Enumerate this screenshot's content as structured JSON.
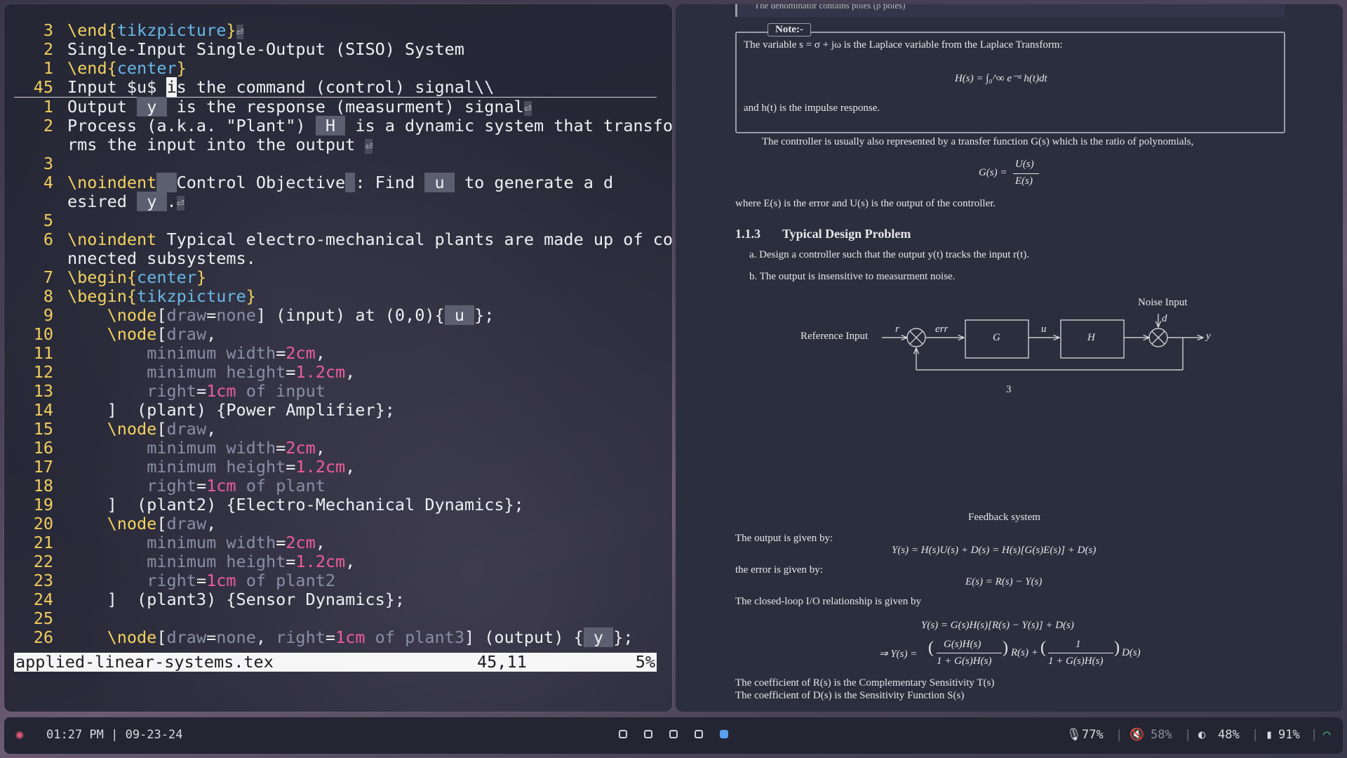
{
  "editor": {
    "lines": [
      {
        "n": "3",
        "segs": [
          [
            "kw",
            "\\end{"
          ],
          [
            "arg",
            "tikzpicture"
          ],
          [
            "kw",
            "}"
          ],
          [
            "ret",
            "⏎"
          ]
        ]
      },
      {
        "n": "2",
        "segs": [
          [
            "t",
            "Single-Input Single-Output (SISO) System"
          ]
        ]
      },
      {
        "n": "1",
        "segs": [
          [
            "kw",
            "\\end{"
          ],
          [
            "arg",
            "center"
          ],
          [
            "kw",
            "}"
          ]
        ]
      },
      {
        "n": "45",
        "cur": true,
        "segs": [
          [
            "t",
            "Input $u$ "
          ],
          [
            "caret",
            "i"
          ],
          [
            "t",
            "s the command (control) signal\\\\"
          ]
        ]
      },
      {
        "n": "1",
        "segs": [
          [
            "t",
            "Output "
          ],
          [
            "mk",
            " y "
          ],
          [
            "t",
            " is the response (measurment) signal"
          ],
          [
            "ret",
            "⏎"
          ]
        ]
      },
      {
        "n": "2",
        "segs": [
          [
            "t",
            "Process (a.k.a. \"Plant\") "
          ],
          [
            "mk",
            " H "
          ],
          [
            "t",
            " is a dynamic system that transfo"
          ]
        ]
      },
      {
        "n": "",
        "segs": [
          [
            "t",
            "rms the input into the output "
          ],
          [
            "ret",
            "⏎"
          ]
        ]
      },
      {
        "n": "3",
        "segs": []
      },
      {
        "n": "4",
        "segs": [
          [
            "kw",
            "\\noindent"
          ],
          [
            "mk",
            "  "
          ],
          [
            "t",
            "Control Objective"
          ],
          [
            "mk",
            " "
          ],
          [
            "t",
            ": Find "
          ],
          [
            "mk",
            " u "
          ],
          [
            "t",
            " to generate a d"
          ]
        ]
      },
      {
        "n": "",
        "segs": [
          [
            "t",
            "esired "
          ],
          [
            "mk",
            " y "
          ],
          [
            "t",
            "."
          ],
          [
            "ret",
            "⏎"
          ]
        ]
      },
      {
        "n": "5",
        "segs": []
      },
      {
        "n": "6",
        "segs": [
          [
            "kw",
            "\\noindent"
          ],
          [
            "t",
            " Typical electro-mechanical plants are made up of co"
          ]
        ]
      },
      {
        "n": "",
        "segs": [
          [
            "t",
            "nnected subsystems."
          ]
        ]
      },
      {
        "n": "7",
        "segs": [
          [
            "kw",
            "\\begin{"
          ],
          [
            "arg",
            "center"
          ],
          [
            "kw",
            "}"
          ]
        ]
      },
      {
        "n": "8",
        "segs": [
          [
            "kw",
            "\\begin{"
          ],
          [
            "arg",
            "tikzpicture"
          ],
          [
            "kw",
            "}"
          ]
        ]
      },
      {
        "n": "9",
        "segs": [
          [
            "t",
            "    "
          ],
          [
            "kw",
            "\\node"
          ],
          [
            "t",
            "["
          ],
          [
            "opt",
            "draw"
          ],
          [
            "t",
            "="
          ],
          [
            "opt",
            "none"
          ],
          [
            "t",
            "] (input) at (0,0){"
          ],
          [
            "mk",
            " u "
          ],
          [
            "t",
            "};"
          ]
        ]
      },
      {
        "n": "10",
        "segs": [
          [
            "t",
            "    "
          ],
          [
            "kw",
            "\\node"
          ],
          [
            "t",
            "["
          ],
          [
            "opt",
            "draw"
          ],
          [
            "t",
            ","
          ]
        ]
      },
      {
        "n": "11",
        "segs": [
          [
            "t",
            "        "
          ],
          [
            "opt",
            "minimum width"
          ],
          [
            "t",
            "="
          ],
          [
            "num",
            "2cm"
          ],
          [
            "t",
            ","
          ]
        ]
      },
      {
        "n": "12",
        "segs": [
          [
            "t",
            "        "
          ],
          [
            "opt",
            "minimum height"
          ],
          [
            "t",
            "="
          ],
          [
            "num",
            "1.2cm"
          ],
          [
            "t",
            ","
          ]
        ]
      },
      {
        "n": "13",
        "segs": [
          [
            "t",
            "        "
          ],
          [
            "opt",
            "right"
          ],
          [
            "t",
            "="
          ],
          [
            "num",
            "1cm"
          ],
          [
            "opt",
            " of input"
          ]
        ]
      },
      {
        "n": "14",
        "segs": [
          [
            "t",
            "    ]  (plant) {Power Amplifier};"
          ]
        ]
      },
      {
        "n": "15",
        "segs": [
          [
            "t",
            "    "
          ],
          [
            "kw",
            "\\node"
          ],
          [
            "t",
            "["
          ],
          [
            "opt",
            "draw"
          ],
          [
            "t",
            ","
          ]
        ]
      },
      {
        "n": "16",
        "segs": [
          [
            "t",
            "        "
          ],
          [
            "opt",
            "minimum width"
          ],
          [
            "t",
            "="
          ],
          [
            "num",
            "2cm"
          ],
          [
            "t",
            ","
          ]
        ]
      },
      {
        "n": "17",
        "segs": [
          [
            "t",
            "        "
          ],
          [
            "opt",
            "minimum height"
          ],
          [
            "t",
            "="
          ],
          [
            "num",
            "1.2cm"
          ],
          [
            "t",
            ","
          ]
        ]
      },
      {
        "n": "18",
        "segs": [
          [
            "t",
            "        "
          ],
          [
            "opt",
            "right"
          ],
          [
            "t",
            "="
          ],
          [
            "num",
            "1cm"
          ],
          [
            "opt",
            " of plant"
          ]
        ]
      },
      {
        "n": "19",
        "segs": [
          [
            "t",
            "    ]  (plant2) {Electro-Mechanical Dynamics};"
          ]
        ]
      },
      {
        "n": "20",
        "segs": [
          [
            "t",
            "    "
          ],
          [
            "kw",
            "\\node"
          ],
          [
            "t",
            "["
          ],
          [
            "opt",
            "draw"
          ],
          [
            "t",
            ","
          ]
        ]
      },
      {
        "n": "21",
        "segs": [
          [
            "t",
            "        "
          ],
          [
            "opt",
            "minimum width"
          ],
          [
            "t",
            "="
          ],
          [
            "num",
            "2cm"
          ],
          [
            "t",
            ","
          ]
        ]
      },
      {
        "n": "22",
        "segs": [
          [
            "t",
            "        "
          ],
          [
            "opt",
            "minimum height"
          ],
          [
            "t",
            "="
          ],
          [
            "num",
            "1.2cm"
          ],
          [
            "t",
            ","
          ]
        ]
      },
      {
        "n": "23",
        "segs": [
          [
            "t",
            "        "
          ],
          [
            "opt",
            "right"
          ],
          [
            "t",
            "="
          ],
          [
            "num",
            "1cm"
          ],
          [
            "opt",
            " of plant2"
          ]
        ]
      },
      {
        "n": "24",
        "segs": [
          [
            "t",
            "    ]  (plant3) {Sensor Dynamics};"
          ]
        ]
      },
      {
        "n": "25",
        "segs": []
      },
      {
        "n": "26",
        "segs": [
          [
            "t",
            "    "
          ],
          [
            "kw",
            "\\node"
          ],
          [
            "t",
            "["
          ],
          [
            "opt",
            "draw"
          ],
          [
            "t",
            "="
          ],
          [
            "opt",
            "none"
          ],
          [
            "t",
            ", "
          ],
          [
            "opt",
            "right"
          ],
          [
            "t",
            "="
          ],
          [
            "num",
            "1cm"
          ],
          [
            "opt",
            " of plant3"
          ],
          [
            "t",
            "] (output) {"
          ],
          [
            "mk",
            " y "
          ],
          [
            "t",
            "};"
          ]
        ]
      }
    ],
    "status": {
      "filename": "applied-linear-systems.tex",
      "position": "45,11",
      "percent": "5%"
    }
  },
  "pdf": {
    "top_fragment": "The denominator contains poles (ρ poles)",
    "note_title": "Note:-",
    "note_line1": "The variable s = σ + jω is the Laplace variable from the Laplace Transform:",
    "note_eq": "H(s) = ∫₀^∞ e⁻ˢᵗ h(t)dt",
    "note_line2": "and h(t) is the impulse response.",
    "controller_text": "The controller is usually also represented by a transfer function G(s) which is the ratio of polynomials,",
    "g_lhs": "G(s) =",
    "g_num": "U(s)",
    "g_den": "E(s)",
    "where_text": "where E(s) is the error and U(s) is the output of the controller.",
    "section_num": "1.1.3",
    "section_title": "Typical Design Problem",
    "item_a": "a.  Design a controller such that the output y(t) tracks the input r(t).",
    "item_b": "b.  The output is insensitive to measurment noise.",
    "diagram": {
      "noise_label": "Noise Input",
      "ref_label": "Reference Input",
      "r": "r",
      "err": "err",
      "G": "G",
      "u": "u",
      "H": "H",
      "d": "d",
      "y": "y",
      "page_number": "3"
    },
    "caption": "Feedback system",
    "output_text": "The output is given by:",
    "output_eq": "Y(s) = H(s)U(s) + D(s) = H(s)[G(s)E(s)] + D(s)",
    "error_text": "the error is given by:",
    "error_eq": "E(s) = R(s) − Y(s)",
    "closed_text": "The closed-loop I/O relationship is given by",
    "closed_eq1": "Y(s) = G(s)H(s)[R(s) − Y(s)] + D(s)",
    "closed_eq2_lhs": "⇒ Y(s) =",
    "closed_eq2_f1_num": "G(s)H(s)",
    "closed_eq2_f1_den": "1 + G(s)H(s)",
    "closed_eq2_mid": "R(s) +",
    "closed_eq2_f2_num": "1",
    "closed_eq2_f2_den": "1 + G(s)H(s)",
    "closed_eq2_end": "D(s)",
    "coef_r": "The coefficient of R(s) is the Complementary Sensitivity T(s)",
    "coef_d": "The coefficient of D(s) is the Sensitivity Function S(s)"
  },
  "bar": {
    "time": "01:27 PM | 09-23-24",
    "mic": "77%",
    "volume": "58%",
    "brightness": "48%",
    "battery": "91%",
    "workspaces": [
      false,
      false,
      false,
      false,
      true
    ]
  },
  "colors": {
    "accent_yellow": "#f2cd5e",
    "keyword_blue": "#68b8e8",
    "number_pink": "#ee5d99",
    "workspace_active": "#5aa0f2"
  }
}
